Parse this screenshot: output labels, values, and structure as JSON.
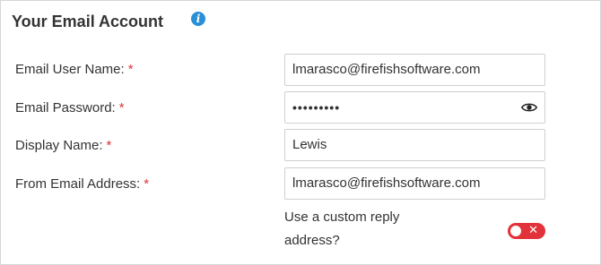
{
  "section": {
    "title": "Your Email Account"
  },
  "fields": {
    "email_user_name": {
      "label": "Email User Name:",
      "required_mark": "*",
      "value": "lmarasco@firefishsoftware.com"
    },
    "email_password": {
      "label": "Email Password:",
      "required_mark": "*",
      "value": "•••••••••"
    },
    "display_name": {
      "label": "Display Name:",
      "required_mark": "*",
      "value": "Lewis"
    },
    "from_email_address": {
      "label": "From Email Address:",
      "required_mark": "*",
      "value": "lmarasco@firefishsoftware.com"
    }
  },
  "custom_reply": {
    "label": "Use a custom reply address?",
    "enabled": false,
    "toggle_glyph": "✕"
  },
  "icons": {
    "info": "info-icon",
    "show_password": "eye-icon"
  },
  "colors": {
    "required": "#d9343a",
    "info": "#2a8fd6",
    "toggle_off": "#e2323a"
  }
}
